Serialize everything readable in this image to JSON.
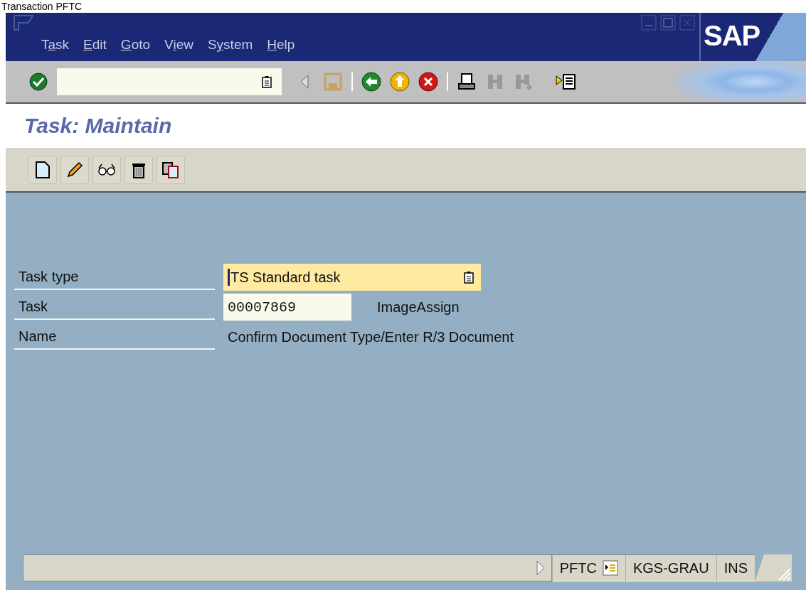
{
  "caption": "Transaction PFTC",
  "menu": [
    {
      "before": "T",
      "key": "a",
      "after": "sk"
    },
    {
      "key": "E",
      "after": "dit"
    },
    {
      "key": "G",
      "after": "oto"
    },
    {
      "before": "V",
      "key": "i",
      "after": "ew"
    },
    {
      "before": "S",
      "key": "y",
      "after": "stem"
    },
    {
      "key": "H",
      "after": "elp"
    }
  ],
  "logo": "SAP",
  "title": "Task: Maintain",
  "form": [
    {
      "label": "Task type",
      "kind": "dropdown",
      "value": "TS Standard task"
    },
    {
      "label": "Task",
      "kind": "input",
      "value": "00007869",
      "description": "ImageAssign"
    },
    {
      "label": "Name",
      "kind": "text",
      "value": "Confirm Document Type/Enter R/3 Document"
    }
  ],
  "status_bar": {
    "transaction": "PFTC",
    "user": "KGS-GRAU",
    "mode": "INS"
  }
}
